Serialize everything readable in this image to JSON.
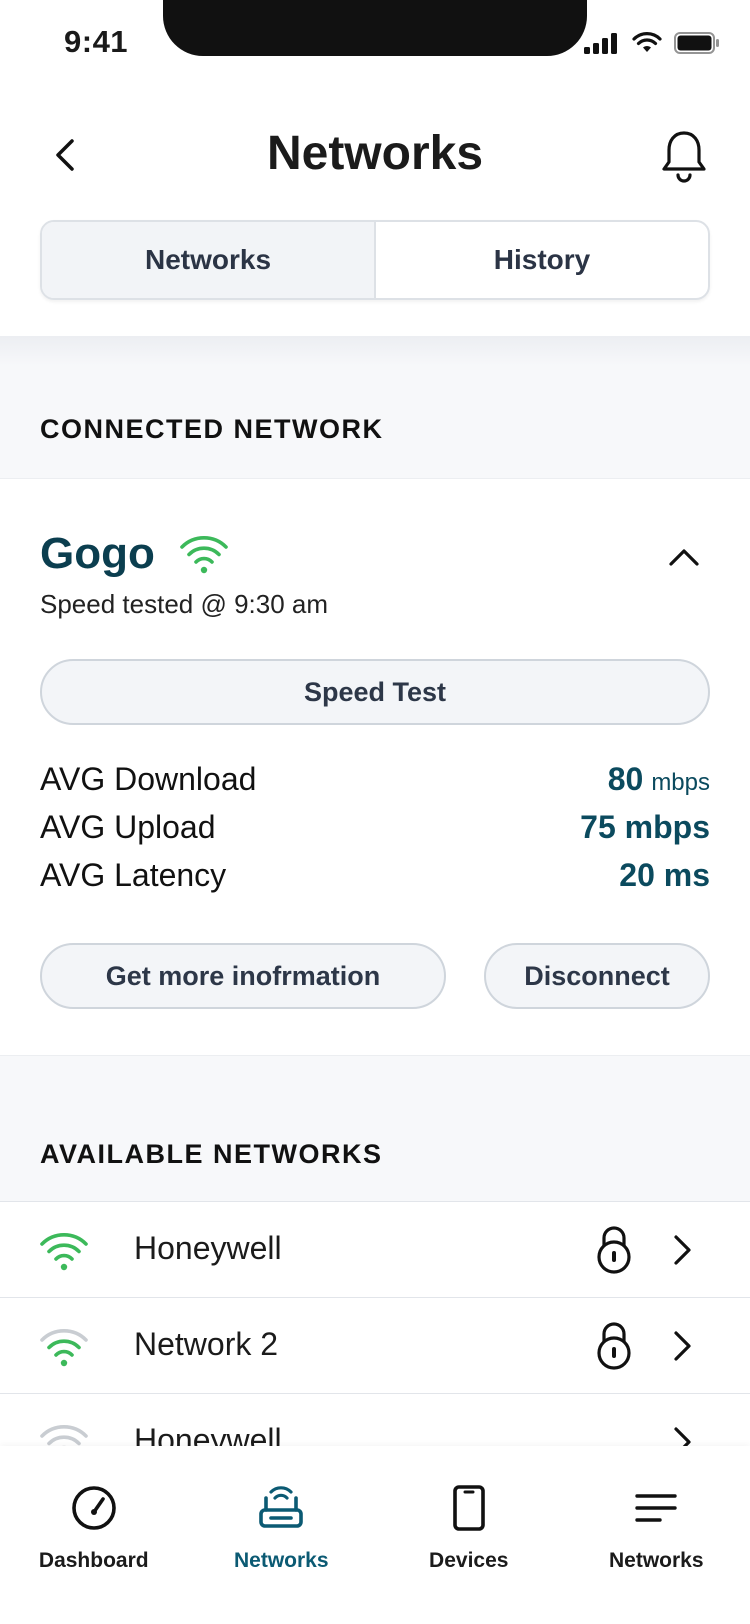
{
  "status_bar": {
    "time": "9:41"
  },
  "header": {
    "title": "Networks"
  },
  "tabs": [
    {
      "label": "Networks",
      "active": true
    },
    {
      "label": "History",
      "active": false
    }
  ],
  "connected": {
    "section_label": "CONNECTED NETWORK",
    "name": "Gogo",
    "speed_tested": "Speed tested @ 9:30 am",
    "speed_test_button": "Speed Test",
    "stats": [
      {
        "label": "AVG Download",
        "value": "80",
        "unit": "mbps"
      },
      {
        "label": "AVG Upload",
        "value": "75 mbps",
        "unit": ""
      },
      {
        "label": "AVG Latency",
        "value": "20 ms",
        "unit": ""
      }
    ],
    "more_info_button": "Get more inofrmation",
    "disconnect_button": "Disconnect"
  },
  "available": {
    "section_label": "AVAILABLE NETWORKS",
    "items": [
      {
        "name": "Honeywell",
        "secured": true,
        "signal": "strong"
      },
      {
        "name": "Network 2",
        "secured": true,
        "signal": "medium"
      },
      {
        "name": "Honeywell",
        "secured": false,
        "signal": "weak"
      }
    ]
  },
  "bottom_nav": [
    {
      "label": "Dashboard",
      "icon": "gauge-icon",
      "active": false
    },
    {
      "label": "Networks",
      "icon": "router-icon",
      "active": true
    },
    {
      "label": "Devices",
      "icon": "phone-icon",
      "active": false
    },
    {
      "label": "Networks",
      "icon": "menu-icon",
      "active": false
    }
  ],
  "colors": {
    "accent": "#0b5a73",
    "wifi_green": "#3cb95a",
    "wifi_grey": "#c9cdd2"
  }
}
